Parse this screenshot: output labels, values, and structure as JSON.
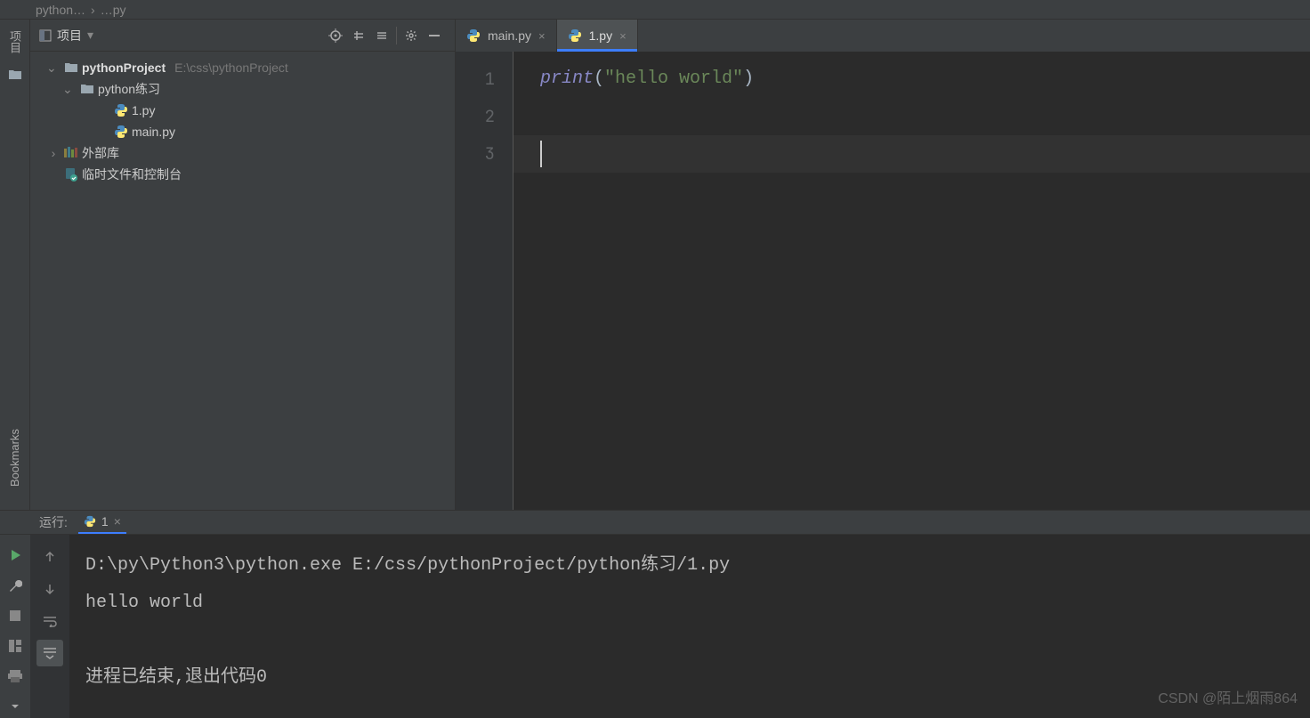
{
  "breadcrumb": {
    "item1": "python…",
    "item2": "…py"
  },
  "left_rail": {
    "project_label": "项目",
    "bookmarks_label": "Bookmarks"
  },
  "project_panel": {
    "title": "项目",
    "root_name": "pythonProject",
    "root_path": "E:\\css\\pythonProject",
    "folder1": "python练习",
    "file1": "1.py",
    "file2": "main.py",
    "ext_libs": "外部库",
    "scratches": "临时文件和控制台"
  },
  "editor": {
    "tabs": [
      {
        "label": "main.py",
        "active": false
      },
      {
        "label": "1.py",
        "active": true
      }
    ],
    "lines": [
      "1",
      "2",
      "3"
    ],
    "code_print": "print",
    "code_open": "(",
    "code_str": "\"hello world\"",
    "code_close": ")"
  },
  "run": {
    "label": "运行:",
    "tab_label": "1",
    "console_line1": "D:\\py\\Python3\\python.exe E:/css/pythonProject/python练习/1.py",
    "console_line2": "hello world",
    "console_line3": "进程已结束,退出代码0"
  },
  "watermark": "CSDN @陌上烟雨864"
}
